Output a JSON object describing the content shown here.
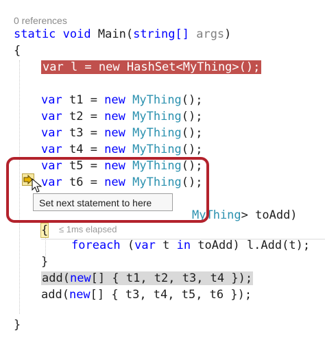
{
  "codelens": {
    "references": "0 references"
  },
  "code": {
    "signature": {
      "kw1": "static",
      "kw2": "void",
      "name": "Main",
      "open": "(",
      "ptype": "string[]",
      "pname": "args",
      "close": ")"
    },
    "open_brace": "{",
    "hashset_line": {
      "kw_var": "var",
      "rest1": " l = ",
      "kw_new": "new",
      "type": "HashSet",
      "generic": "<MyThing>",
      "tail": "();"
    },
    "thing_lines": [
      {
        "name": "t1"
      },
      {
        "name": "t2"
      },
      {
        "name": "t3"
      },
      {
        "name": "t4"
      },
      {
        "name": "t5"
      },
      {
        "name": "t6"
      }
    ],
    "thing_kw_var": "var",
    "thing_kw_new": "new",
    "thing_type": "MyThing",
    "thing_tail": "();",
    "partial_line": {
      "type": "MyThing",
      "tail": "> toAdd)"
    },
    "elapsed": "≤ 1ms elapsed",
    "inner_brace_open": "{",
    "foreach_line": {
      "kw": "foreach",
      "mid1": " (",
      "kw_var": "var",
      "mid2": " t ",
      "kw_in": "in",
      "tail": " toAdd) l.Add(t);"
    },
    "inner_brace_close": "}",
    "add_line1": {
      "fn": "add(",
      "kw_new": "new",
      "rest": "[] { t1, t2, t3, t4 });"
    },
    "add_line2": {
      "fn": "add(",
      "kw_new": "new",
      "rest": "[] { t3, t4, t5, t6 });"
    },
    "close_brace": "}"
  },
  "tooltip": {
    "text": "Set next statement to here"
  },
  "icons": {
    "next_statement": "next-statement-arrow-icon",
    "cursor": "mouse-pointer-icon"
  },
  "colors": {
    "keyword": "#0000ff",
    "type": "#2b91af",
    "highlight_current": "#c0504d",
    "callout": "#b3222c"
  }
}
